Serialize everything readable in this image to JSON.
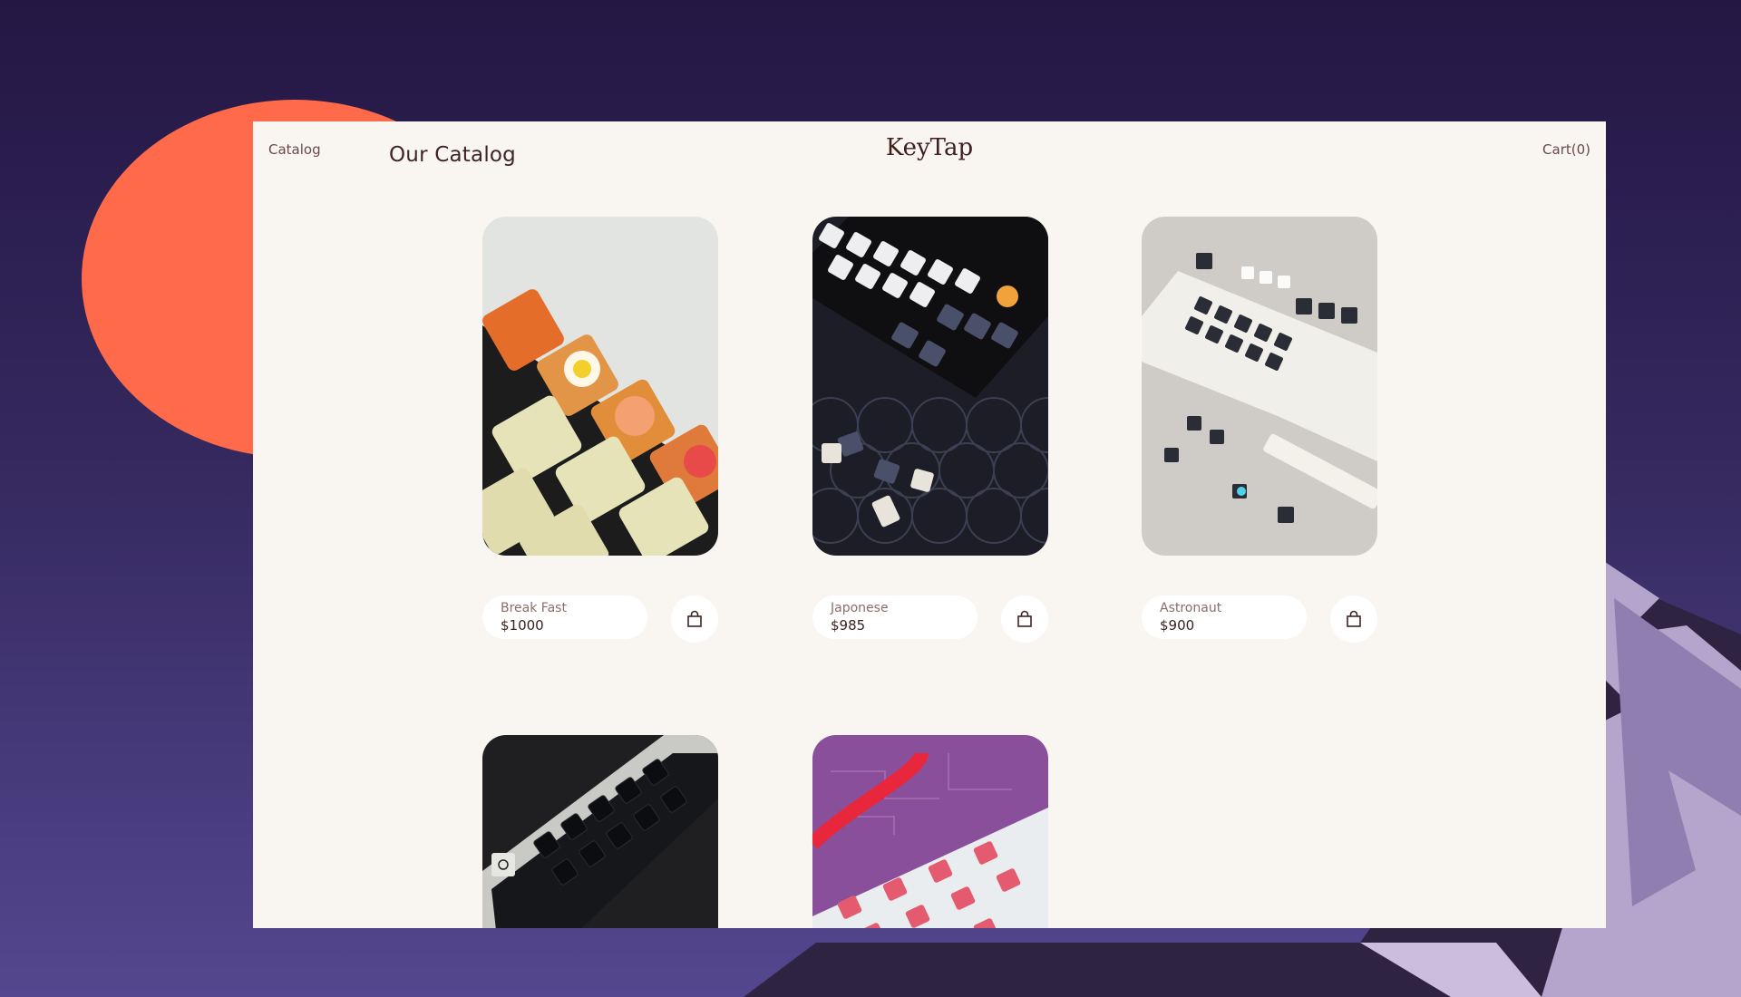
{
  "header": {
    "nav_catalog": "Catalog",
    "page_title": "Our Catalog",
    "logo": "KeyTap",
    "cart": "Cart(0)"
  },
  "products": [
    {
      "name": "Break Fast",
      "price": "$1000",
      "image": "breakfast-keycaps"
    },
    {
      "name": "Japonese",
      "price": "$985",
      "image": "japanese-keycaps"
    },
    {
      "name": "Astronaut",
      "price": "$900",
      "image": "astronaut-keycaps"
    },
    {
      "name": "",
      "price": "",
      "image": "black-keycaps"
    },
    {
      "name": "",
      "price": "",
      "image": "pink-keycaps"
    }
  ],
  "icons": {
    "cart_button": "shopping-bag-icon"
  },
  "colors": {
    "background_top": "#241744",
    "background_bottom": "#54478f",
    "sun": "#ff6a4a",
    "panel": "#f9f6f2",
    "text_dark": "#3e2623"
  }
}
